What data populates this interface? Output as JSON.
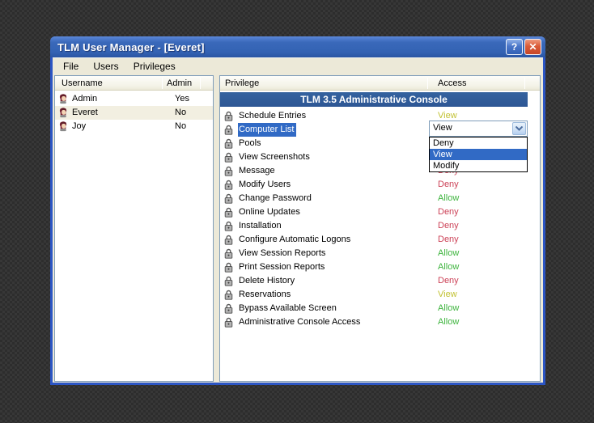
{
  "window": {
    "title": "TLM User Manager - [Everet]",
    "help_button_label": "?",
    "close_button_label": "✕"
  },
  "menu": {
    "items": [
      "File",
      "Users",
      "Privileges"
    ]
  },
  "users_panel": {
    "columns": [
      "Username",
      "Admin"
    ],
    "rows": [
      {
        "name": "Admin",
        "admin": "Yes",
        "selected": false
      },
      {
        "name": "Everet",
        "admin": "No",
        "selected": true
      },
      {
        "name": "Joy",
        "admin": "No",
        "selected": false
      }
    ]
  },
  "privileges_panel": {
    "columns": [
      "Privilege",
      "Access"
    ],
    "banner": "TLM 3.5 Administrative Console",
    "rows": [
      {
        "label": "Schedule Entries",
        "access": "View",
        "selected": false
      },
      {
        "label": "Computer List",
        "access": "",
        "selected": true
      },
      {
        "label": "Pools",
        "access": "",
        "selected": false
      },
      {
        "label": "View Screenshots",
        "access": "",
        "selected": false
      },
      {
        "label": "Message",
        "access": "Deny",
        "selected": false
      },
      {
        "label": "Modify Users",
        "access": "Deny",
        "selected": false
      },
      {
        "label": "Change Password",
        "access": "Allow",
        "selected": false
      },
      {
        "label": "Online Updates",
        "access": "Deny",
        "selected": false
      },
      {
        "label": "Installation",
        "access": "Deny",
        "selected": false
      },
      {
        "label": "Configure Automatic Logons",
        "access": "Deny",
        "selected": false
      },
      {
        "label": "View Session Reports",
        "access": "Allow",
        "selected": false
      },
      {
        "label": "Print Session Reports",
        "access": "Allow",
        "selected": false
      },
      {
        "label": "Delete History",
        "access": "Deny",
        "selected": false
      },
      {
        "label": "Reservations",
        "access": "View",
        "selected": false
      },
      {
        "label": "Bypass Available Screen",
        "access": "Allow",
        "selected": false
      },
      {
        "label": "Administrative Console Access",
        "access": "Allow",
        "selected": false
      }
    ],
    "access_colors": {
      "View": "#c2c233",
      "Allow": "#3db43d",
      "Deny": "#cc4257"
    }
  },
  "combo": {
    "value": "View",
    "options": [
      "Deny",
      "View",
      "Modify"
    ],
    "selected_option": "View"
  },
  "colors": {
    "title_accent": "#3a69ba",
    "selection_blue": "#316AC5",
    "window_border": "#2b55c4",
    "dialog_bg": "#ECE9D8"
  }
}
